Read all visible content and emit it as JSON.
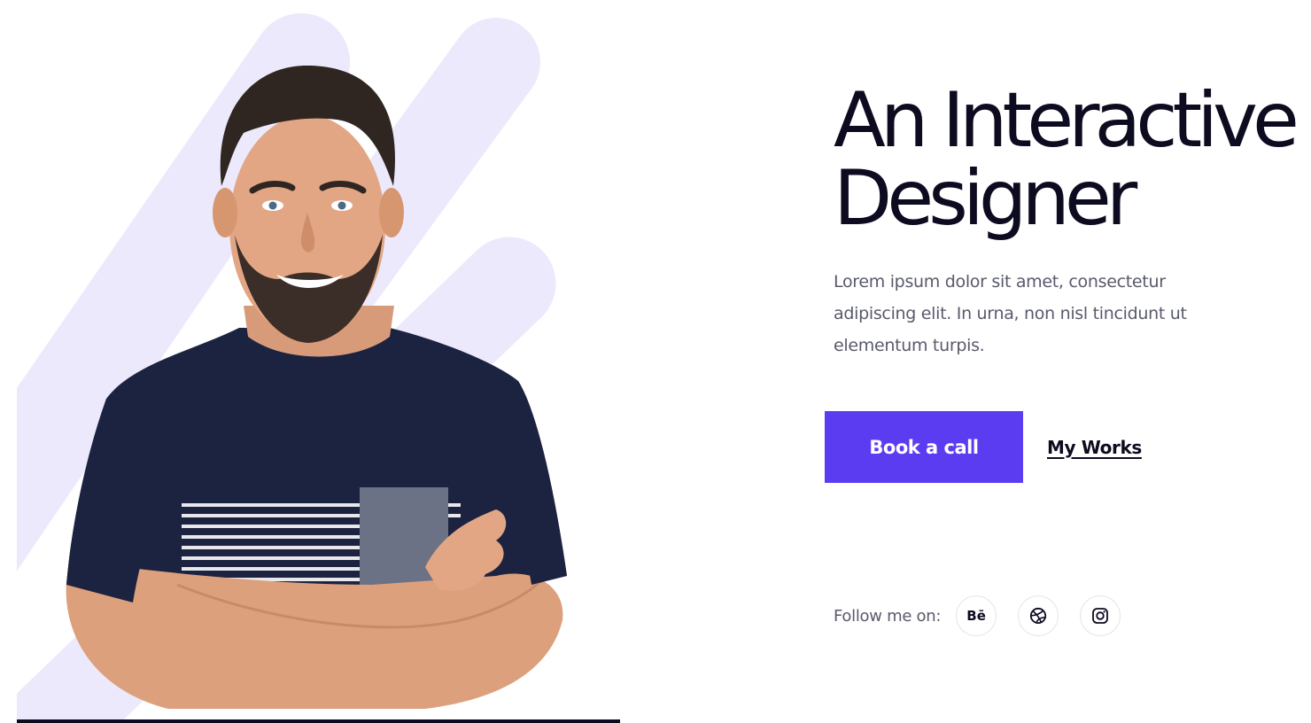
{
  "hero": {
    "title_line1": "An Interactive",
    "title_line2": "Designer",
    "description": "Lorem ipsum dolor sit amet, consectetur adipiscing elit. In urna, non nisl tincidunt ut elementum turpis.",
    "primary_button": "Book a call",
    "secondary_link": "My Works"
  },
  "social": {
    "label": "Follow me on:",
    "items": [
      {
        "icon": "behance-icon",
        "glyph": "Bē"
      },
      {
        "icon": "dribbble-icon"
      },
      {
        "icon": "instagram-icon"
      }
    ]
  },
  "colors": {
    "accent": "#5b3cf0",
    "stripe": "#ece9fc",
    "heading": "#0d0b1f",
    "body_text": "#595a6b"
  }
}
